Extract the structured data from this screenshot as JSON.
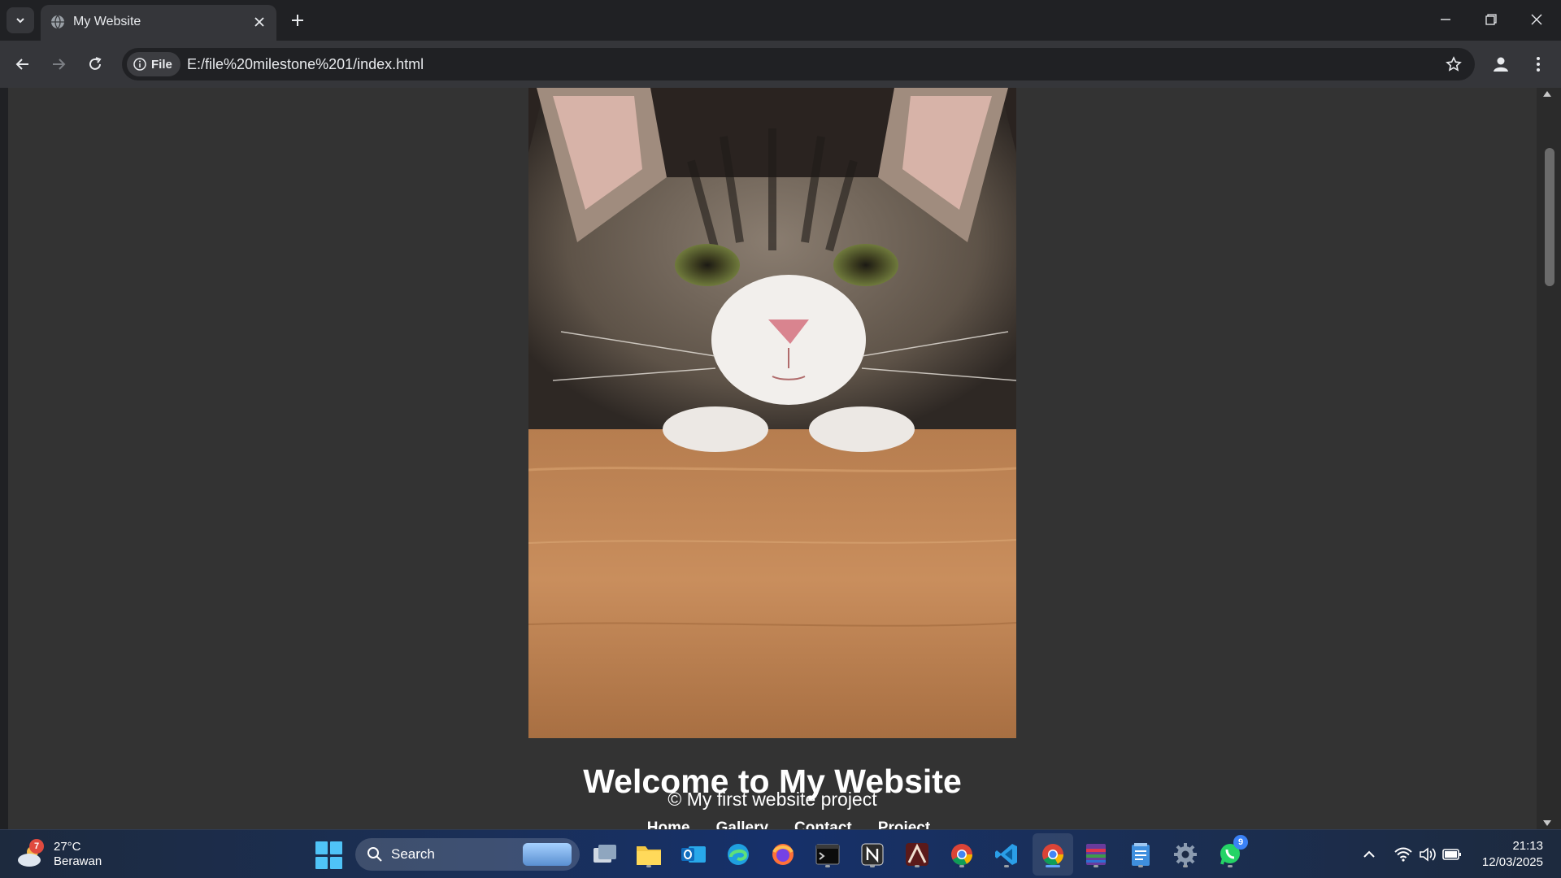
{
  "browser": {
    "tab": {
      "title": "My Website"
    },
    "address": {
      "chip_label": "File",
      "url": "E:/file%20milestone%201/index.html"
    }
  },
  "page": {
    "heading": "Welcome to My Website",
    "footer_text": "© My first website project",
    "nav": [
      "Home",
      "Gallery",
      "Contact",
      "Project"
    ],
    "colors": {
      "background": "#333333",
      "text": "#ffffff"
    }
  },
  "taskbar": {
    "weather": {
      "badge": "7",
      "temp": "27°C",
      "desc": "Berawan"
    },
    "search_label": "Search",
    "whatsapp_badge": "9",
    "clock": {
      "time": "21:13",
      "date": "12/03/2025"
    }
  }
}
